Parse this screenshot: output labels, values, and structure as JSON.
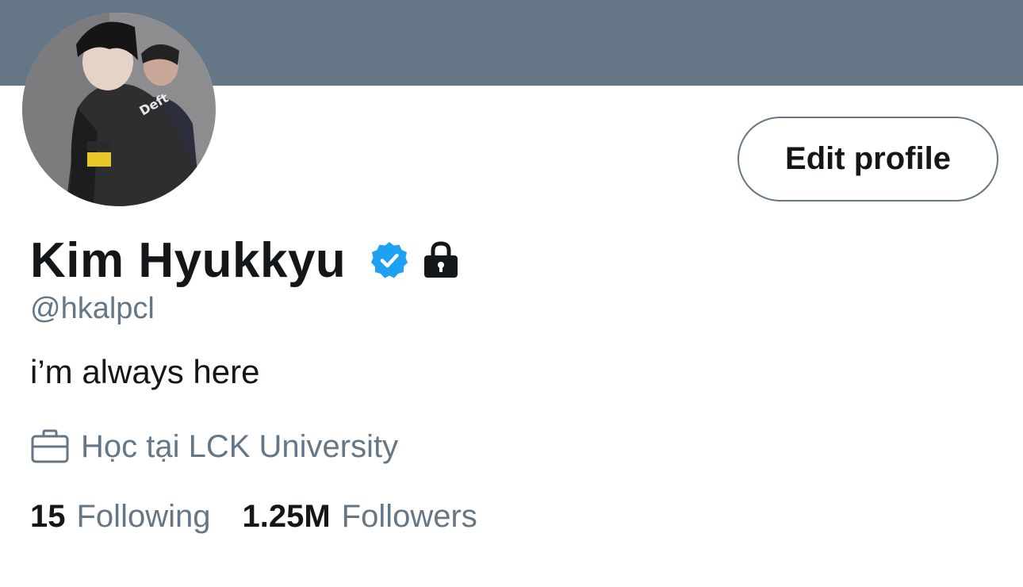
{
  "colors": {
    "banner": "#657786",
    "primary_text": "#14171a",
    "secondary_text": "#657786",
    "verified_blue": "#1da1f2"
  },
  "profile": {
    "name": "Kim Hyukkyu",
    "handle": "@hkalpcl",
    "bio": "i’m always here",
    "work": "Học tại LCK University",
    "avatar_jacket_text": "Deft",
    "badges": [
      "verified-icon",
      "lock-icon"
    ]
  },
  "actions": {
    "edit_profile_label": "Edit profile"
  },
  "stats": {
    "following_count": "15",
    "following_label": "Following",
    "followers_count": "1.25M",
    "followers_label": "Followers"
  }
}
